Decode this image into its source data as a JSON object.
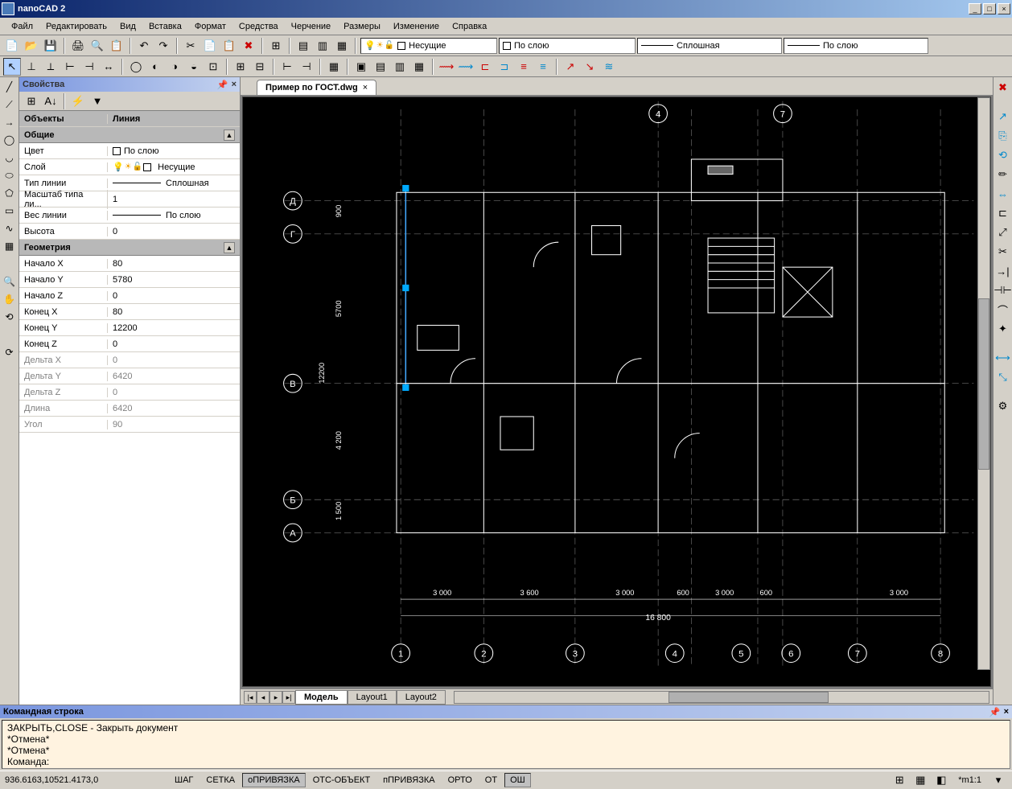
{
  "app": {
    "title": "nanoCAD 2"
  },
  "menu": [
    "Файл",
    "Редактировать",
    "Вид",
    "Вставка",
    "Формат",
    "Средства",
    "Черчение",
    "Размеры",
    "Изменение",
    "Справка"
  ],
  "toolbar1": {
    "layer_combo": "Несущие",
    "color_combo": "По слою",
    "linetype_combo": "Сплошная",
    "lineweight_combo": "По слою"
  },
  "properties": {
    "title": "Свойства",
    "objects_label": "Объекты",
    "objects_value": "Линия",
    "sections": {
      "general": "Общие",
      "geometry": "Геометрия"
    },
    "general": [
      {
        "k": "Цвет",
        "v": "По слою",
        "swatch": true
      },
      {
        "k": "Слой",
        "v": "Несущие",
        "layer_icons": true
      },
      {
        "k": "Тип линии",
        "v": "Сплошная",
        "line": true
      },
      {
        "k": "Масштаб типа ли...",
        "v": "1"
      },
      {
        "k": "Вес линии",
        "v": "По слою",
        "line": true
      },
      {
        "k": "Высота",
        "v": "0"
      }
    ],
    "geometry": [
      {
        "k": "Начало X",
        "v": "80"
      },
      {
        "k": "Начало Y",
        "v": "5780"
      },
      {
        "k": "Начало Z",
        "v": "0"
      },
      {
        "k": "Конец X",
        "v": "80"
      },
      {
        "k": "Конец Y",
        "v": "12200"
      },
      {
        "k": "Конец Z",
        "v": "0"
      },
      {
        "k": "Дельта X",
        "v": "0",
        "disabled": true
      },
      {
        "k": "Дельта Y",
        "v": "6420",
        "disabled": true
      },
      {
        "k": "Дельта Z",
        "v": "0",
        "disabled": true
      },
      {
        "k": "Длина",
        "v": "6420",
        "disabled": true
      },
      {
        "k": "Угол",
        "v": "90",
        "disabled": true
      }
    ]
  },
  "document": {
    "tab": "Пример по ГОСТ.dwg"
  },
  "drawing": {
    "axis_letters": [
      "Д",
      "Г",
      "В",
      "Б",
      "А"
    ],
    "axis_numbers_top": [
      "4",
      "7"
    ],
    "axis_numbers_bottom": [
      "1",
      "2",
      "3",
      "4",
      "5",
      "6",
      "7",
      "8"
    ],
    "vert_dims": [
      "900",
      "5700",
      "12200",
      "4 200",
      "1 500"
    ],
    "horiz_dims": [
      "3 000",
      "3 600",
      "3 000",
      "600",
      "3 000",
      "600",
      "3 000"
    ],
    "total_dim": "16 800"
  },
  "layout_tabs": {
    "active": "Модель",
    "others": [
      "Layout1",
      "Layout2"
    ]
  },
  "command": {
    "title": "Командная строка",
    "lines": [
      "ЗАКРЫТЬ,CLOSE - Закрыть документ",
      "*Отмена*",
      "*Отмена*",
      "Команда:"
    ]
  },
  "status": {
    "coords": "936.6163,10521.4173,0",
    "toggles": [
      {
        "label": "ШАГ",
        "active": false
      },
      {
        "label": "СЕТКА",
        "active": false
      },
      {
        "label": "оПРИВЯЗКА",
        "active": true
      },
      {
        "label": "ОТС-ОБЪЕКТ",
        "active": false
      },
      {
        "label": "пПРИВЯЗКА",
        "active": false
      },
      {
        "label": "ОРТО",
        "active": false
      },
      {
        "label": "ОТ",
        "active": false
      },
      {
        "label": "ОШ",
        "active": true
      }
    ],
    "zoom": "*m1:1"
  }
}
